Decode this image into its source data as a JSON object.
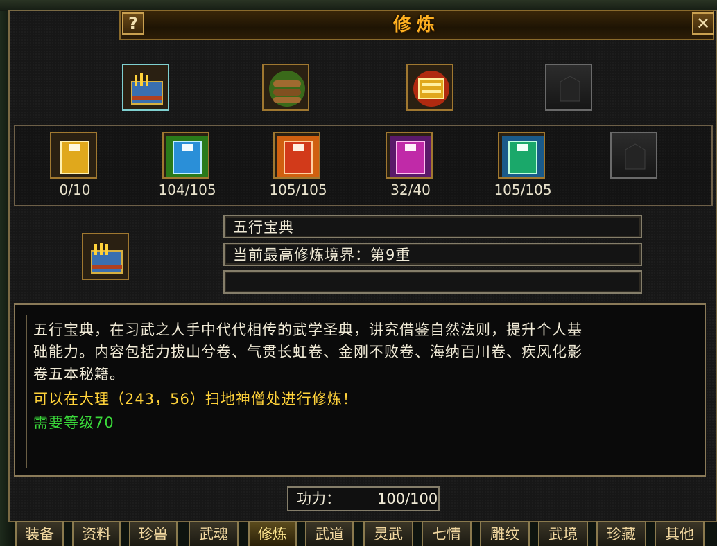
{
  "window": {
    "title": "修炼",
    "help_label": "?",
    "close_label": "✕"
  },
  "top_items": [
    {
      "name": "五行宝典",
      "color": "#3a6fb0"
    },
    {
      "name": "scroll-bundle",
      "color": "#6a8a2a"
    },
    {
      "name": "gold-treasure",
      "color": "#d08a10"
    },
    {
      "name": "empty",
      "color": ""
    }
  ],
  "books": [
    {
      "count": "0/10",
      "color": "#e0a81c"
    },
    {
      "count": "104/105",
      "color": "#2a8fd8"
    },
    {
      "count": "105/105",
      "color": "#d23a1a"
    },
    {
      "count": "32/40",
      "color": "#c02aa8"
    },
    {
      "count": "105/105",
      "color": "#1aa86a"
    },
    {
      "count": "",
      "color": ""
    }
  ],
  "detail": {
    "name": "五行宝典",
    "realm": "当前最高修炼境界：第9重",
    "extra": ""
  },
  "description": {
    "line1": "五行宝典，在习武之人手中代代相传的武学圣典，讲究借鉴自然法则，提升个人基",
    "line2": "础能力。内容包括力拔山兮卷、气贯长虹卷、金刚不败卷、海纳百川卷、疾风化影",
    "line3": "卷五本秘籍。",
    "location": "可以在大理（243，56）扫地神僧处进行修炼！",
    "requirement": "需要等级70"
  },
  "power": {
    "label": "功力：",
    "value": "100/100"
  },
  "tabs": [
    "装备",
    "资料",
    "珍兽",
    "武魂",
    "修炼",
    "武道",
    "灵武",
    "七情",
    "雕纹",
    "武境",
    "珍藏",
    "其他"
  ],
  "active_tab": "修炼",
  "colors": {
    "title": "#ffb020",
    "location_text": "#ffd23a",
    "requirement_text": "#3ad83a",
    "border": "#a07830"
  }
}
